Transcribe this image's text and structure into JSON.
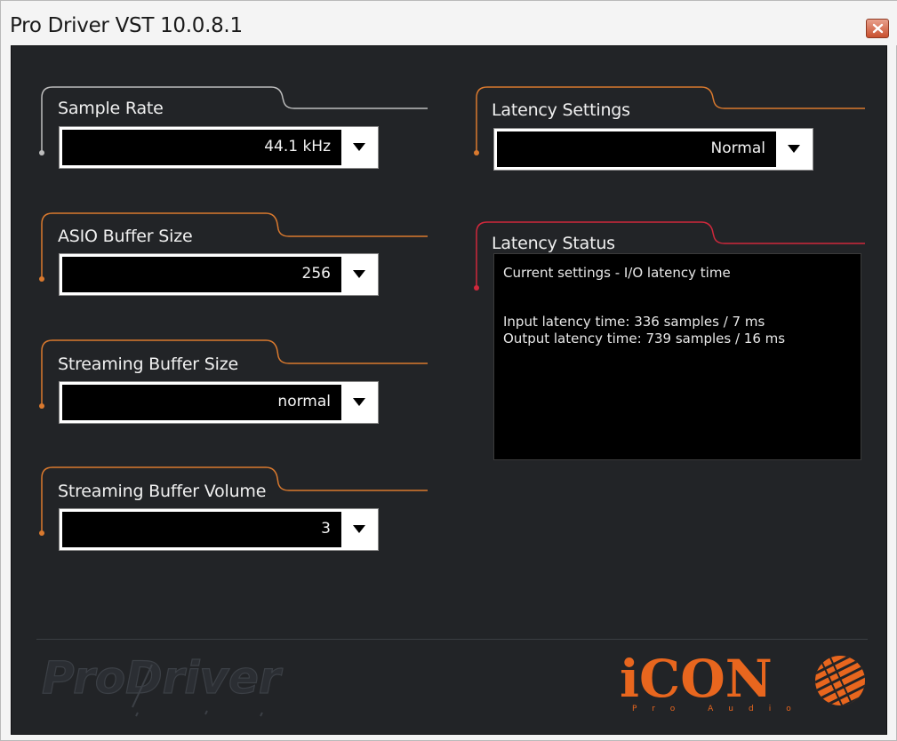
{
  "window": {
    "title": "Pro Driver VST 10.0.8.1"
  },
  "left_panel": {
    "sample_rate": {
      "label": "Sample Rate",
      "value": "44.1 kHz"
    },
    "asio_buffer_size": {
      "label": "ASIO Buffer Size",
      "value": "256"
    },
    "streaming_buffer_size": {
      "label": "Streaming Buffer Size",
      "value": "normal"
    },
    "streaming_buffer_volume": {
      "label": "Streaming Buffer Volume",
      "value": "3"
    }
  },
  "right_panel": {
    "latency_settings": {
      "label": "Latency Settings",
      "value": "Normal"
    },
    "latency_status": {
      "label": "Latency Status",
      "lines": [
        "Current settings - I/O latency time",
        "",
        "Input latency time: 336 samples / 7 ms",
        "Output latency time: 739 samples / 16 ms"
      ]
    }
  },
  "footer": {
    "prodriver_logo_text": "ProDriver",
    "icon_logo_text": "iCON",
    "icon_logo_subtext": "Pro Audio"
  },
  "icons": {
    "close": "close-icon",
    "dropdown": "triangle-down-icon"
  },
  "colors": {
    "orange_accent": "#d9792e",
    "red_accent": "#d0283c",
    "grey_accent": "#bdbdbd",
    "panel_background": "#222427",
    "icon_brand_orange": "#e8661e"
  }
}
